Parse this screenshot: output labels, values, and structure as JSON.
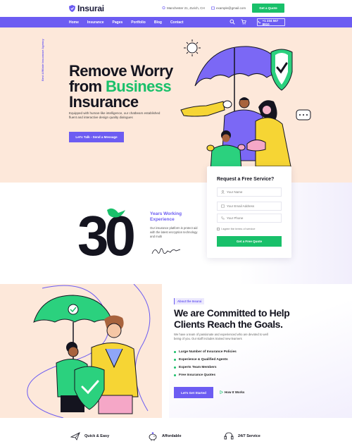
{
  "brand": {
    "name": "Insurai",
    "accent": "#6c5cf2",
    "green": "#19c06a"
  },
  "topbar": {
    "address": "Manchester 21, Zurich, CH",
    "email": "example@gmail.com",
    "quote_label": "Get a Quote"
  },
  "nav": {
    "items": [
      "Home",
      "Insurance",
      "Pages",
      "Portfolio",
      "Blog",
      "Contact"
    ],
    "phone": "+1 234 567 8910",
    "icons": [
      "search-icon",
      "cart-icon",
      "phone-icon"
    ]
  },
  "hero": {
    "vertical_text": "Best Affiliate Insurance Agency",
    "title_line1": "Remove Worry",
    "title_line2a": "from ",
    "title_line2b": "Business",
    "title_line3": "Insurance",
    "description": "Equipped with human-like intelligence, our chatbears established fluent and interactive design quality dialogues",
    "cta_label": "Let's Talk - Send a Message"
  },
  "stats": {
    "number": "30",
    "years_label_1": "Years Working",
    "years_label_2": "Experience",
    "description": "Our insurance platform is protect aid with the latest encryption technology and multi"
  },
  "form": {
    "title": "Request a Free Service?",
    "name_placeholder": "Your Name",
    "email_placeholder": "Your Email Address",
    "phone_placeholder": "Your Phone",
    "agree_text": "I agree the terms of service",
    "submit_label": "Get a Free Quote"
  },
  "about": {
    "badge": "About the Insurai",
    "title": "We are Committed to Help Clients Reach the Goals.",
    "description": "We have a team of passionate and experienced who are devoted to well being of you. Our staff includes trained new learners",
    "list": [
      "Large Number of Insurance Policies",
      "Experience & Qualified Agents",
      "Experts Team Members",
      "Free Insurance Quotes"
    ],
    "cta_label": "Let's Get Started",
    "how_label": "How It Works"
  },
  "features": [
    {
      "label": "Quick & Easy",
      "icon": "plane-icon"
    },
    {
      "label": "Affordable",
      "icon": "piggy-icon"
    },
    {
      "label": "24/7 Service",
      "icon": "support-icon"
    }
  ]
}
